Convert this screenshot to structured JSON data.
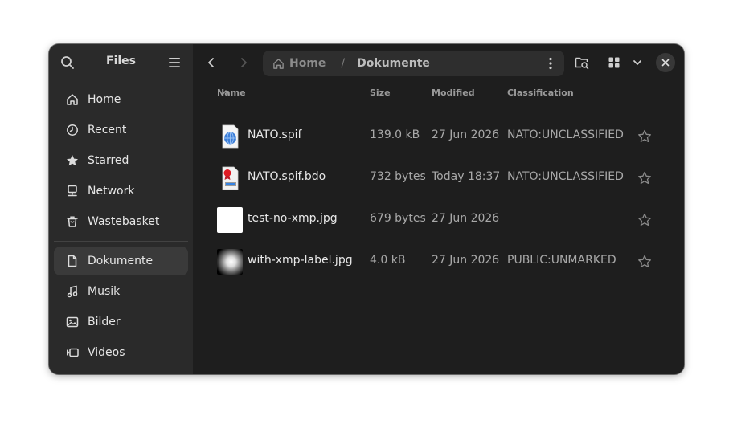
{
  "app": {
    "title": "Files"
  },
  "sidebar": {
    "items": [
      {
        "label": "Home",
        "icon": "home-icon"
      },
      {
        "label": "Recent",
        "icon": "clock-icon"
      },
      {
        "label": "Starred",
        "icon": "star-icon"
      },
      {
        "label": "Network",
        "icon": "network-icon"
      },
      {
        "label": "Wastebasket",
        "icon": "trash-icon"
      }
    ],
    "places": [
      {
        "label": "Dokumente",
        "icon": "document-icon",
        "active": true
      },
      {
        "label": "Musik",
        "icon": "music-icon"
      },
      {
        "label": "Bilder",
        "icon": "picture-icon"
      },
      {
        "label": "Videos",
        "icon": "video-icon"
      }
    ]
  },
  "pathbar": {
    "home": "Home",
    "separator": "/",
    "current": "Dokumente"
  },
  "columns": {
    "name": "Name",
    "size": "Size",
    "modified": "Modified",
    "classification": "Classification"
  },
  "files": [
    {
      "name": "NATO.spif",
      "size": "139.0 kB",
      "modified": "27 Jun 2026",
      "classification": "NATO:UNCLASSIFIED",
      "thumb": "globe-document"
    },
    {
      "name": "NATO.spif.bdo",
      "size": "732 bytes",
      "modified": "Today 18:37",
      "classification": "NATO:UNCLASSIFIED",
      "thumb": "certificate-document"
    },
    {
      "name": "test-no-xmp.jpg",
      "size": "679 bytes",
      "modified": "27 Jun 2026",
      "classification": "",
      "thumb": "white-image"
    },
    {
      "name": "with-xmp-label.jpg",
      "size": "4.0 kB",
      "modified": "27 Jun 2026",
      "classification": "PUBLIC:UNMARKED",
      "thumb": "gradient-image"
    }
  ],
  "colors": {
    "window_bg": "#1e1e1e",
    "sidebar_bg": "#2a2a2a",
    "active_item": "#3a3a3a",
    "text": "#e6e6e6",
    "muted": "#a8a8a8"
  }
}
